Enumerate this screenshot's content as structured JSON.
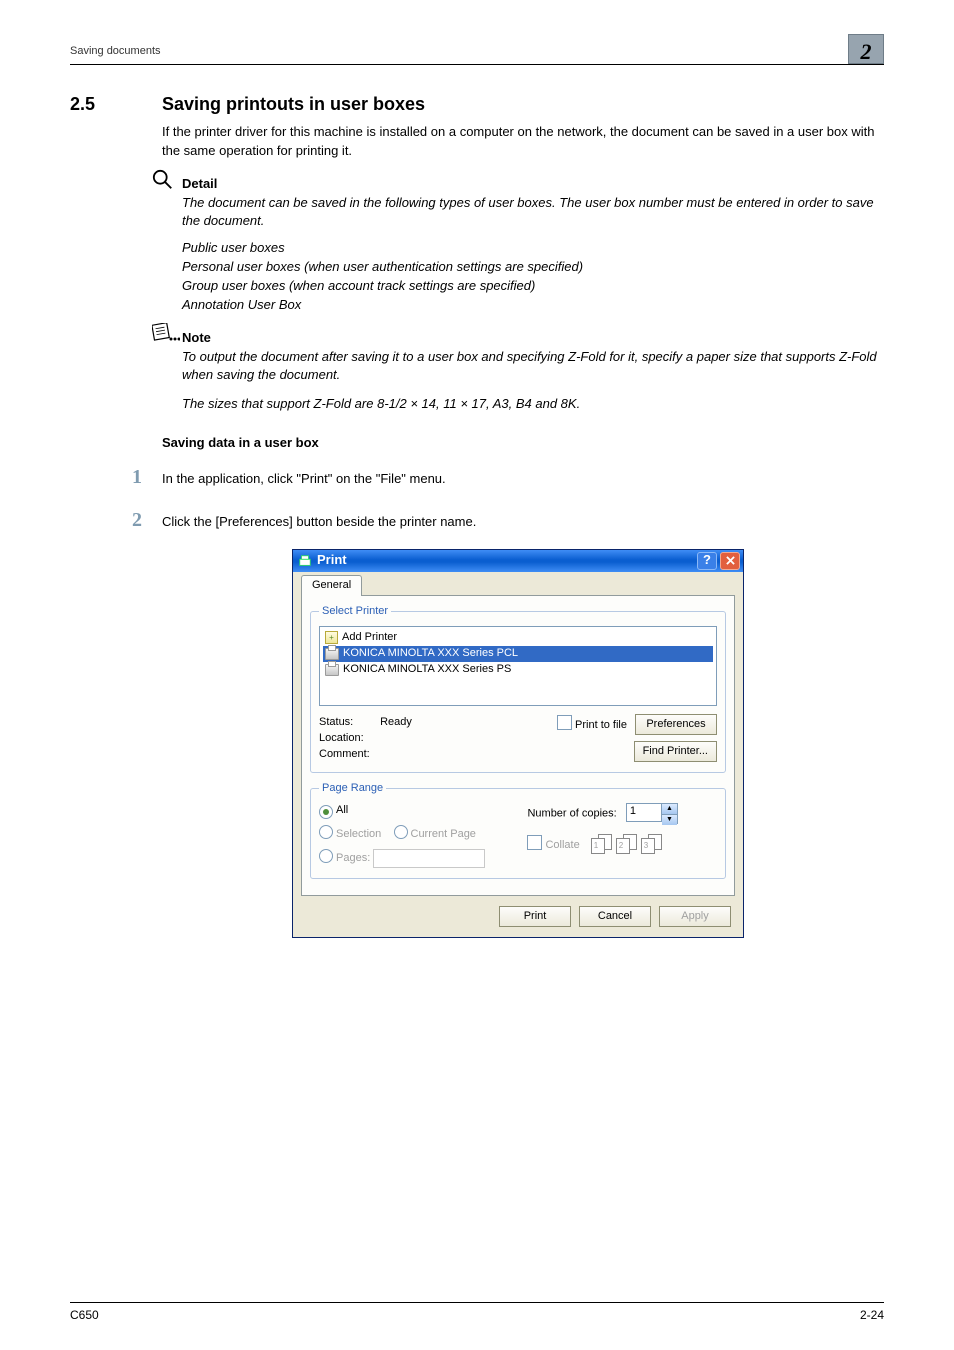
{
  "header": {
    "running_title": "Saving documents",
    "chapter_number": "2"
  },
  "section": {
    "number": "2.5",
    "title": "Saving printouts in user boxes",
    "intro": "If the printer driver for this machine is installed on a computer on the network, the document can be saved in a user box with the same operation for printing it."
  },
  "detail": {
    "heading": "Detail",
    "para": "The document can be saved in the following types of user boxes. The user box number must be entered in order to save the document.",
    "items": [
      "Public user boxes",
      "Personal user boxes (when user authentication settings are specified)",
      "Group user boxes (when account track settings are specified)",
      "Annotation User Box"
    ]
  },
  "note": {
    "heading": "Note",
    "para1": "To output the document after saving it to a user box and  specifying Z-Fold for it, specify a paper size that supports Z-Fold  when saving the document.",
    "para2": "The sizes that support Z-Fold are 8-1/2 × 14, 11 × 17, A3, B4 and 8K."
  },
  "procedure": {
    "subheading": "Saving data in a user box",
    "steps": [
      {
        "n": "1",
        "text": "In the application, click \"Print\" on the \"File\" menu."
      },
      {
        "n": "2",
        "text": "Click the [Preferences] button beside the printer name."
      }
    ]
  },
  "dialog": {
    "title": "Print",
    "tab_label": "General",
    "select_printer_legend": "Select Printer",
    "printers": {
      "add": "Add Printer",
      "sel": "KONICA MINOLTA  XXX  Series PCL",
      "other": "KONICA MINOLTA  XXX  Series PS"
    },
    "status": {
      "status_label": "Status:",
      "status_value": "Ready",
      "location_label": "Location:",
      "comment_label": "Comment:"
    },
    "controls": {
      "print_to_file": "Print to file",
      "preferences": "Preferences",
      "find_printer": "Find Printer..."
    },
    "page_range": {
      "legend": "Page Range",
      "all": "All",
      "selection": "Selection",
      "current_page": "Current Page",
      "pages": "Pages:"
    },
    "copies": {
      "label": "Number of copies:",
      "value": "1",
      "collate": "Collate",
      "graphic": [
        {
          "a": "1",
          "b": "1"
        },
        {
          "a": "2",
          "b": "2"
        },
        {
          "a": "3",
          "b": "3"
        }
      ]
    },
    "footer": {
      "print": "Print",
      "cancel": "Cancel",
      "apply": "Apply"
    }
  },
  "footer": {
    "model": "C650",
    "page_no": "2-24"
  }
}
